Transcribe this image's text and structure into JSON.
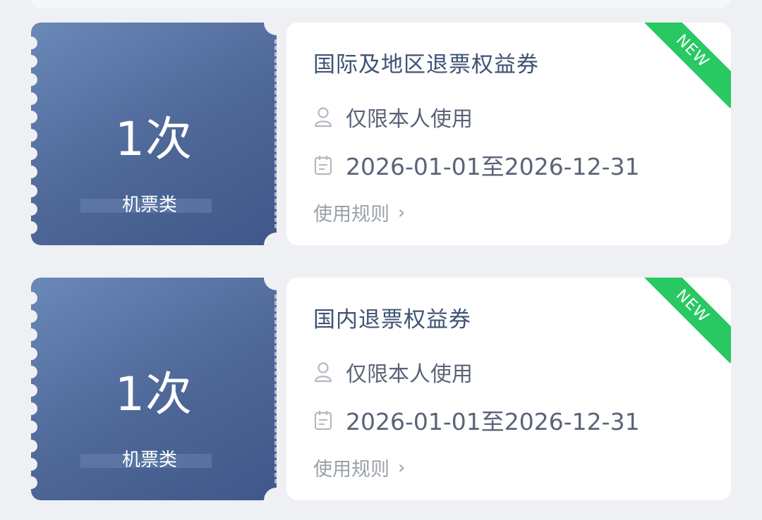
{
  "coupons": [
    {
      "count": "1次",
      "category": "机票类",
      "title": "国际及地区退票权益券",
      "user_limit": "仅限本人使用",
      "validity": "2026-01-01至2026-12-31",
      "rules_link": "使用规则",
      "badge": "NEW"
    },
    {
      "count": "1次",
      "category": "机票类",
      "title": "国内退票权益券",
      "user_limit": "仅限本人使用",
      "validity": "2026-01-01至2026-12-31",
      "rules_link": "使用规则",
      "badge": "NEW"
    }
  ],
  "colors": {
    "stub_blue": "#4d6797",
    "badge_green": "#28c862",
    "title_text": "#3e5273"
  },
  "icons": [
    "user-icon",
    "calendar-icon",
    "chevron-right-icon"
  ]
}
